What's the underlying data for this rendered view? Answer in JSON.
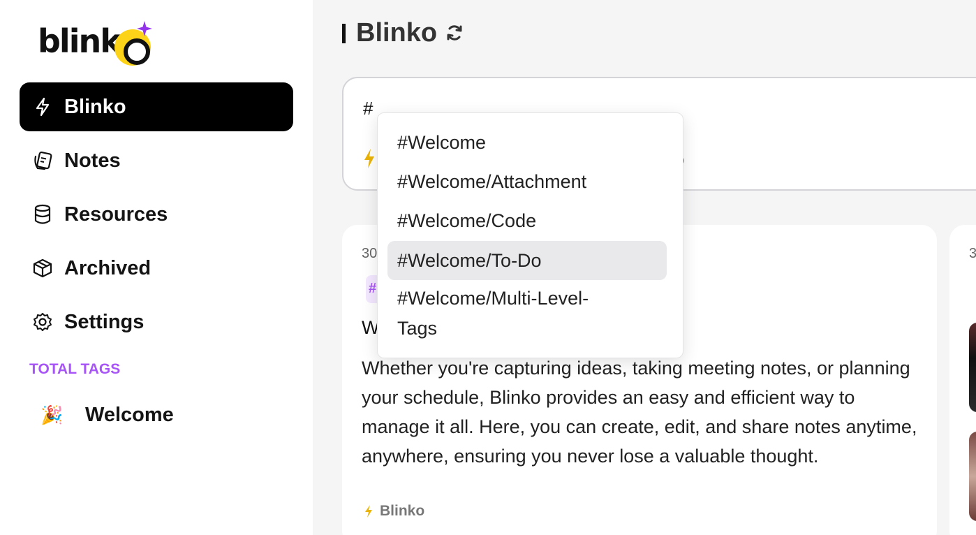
{
  "brand": {
    "logo_text": "blink"
  },
  "sidebar": {
    "items": [
      {
        "label": "Blinko",
        "icon": "bolt-icon",
        "active": true
      },
      {
        "label": "Notes",
        "icon": "notes-icon",
        "active": false
      },
      {
        "label": "Resources",
        "icon": "database-icon",
        "active": false
      },
      {
        "label": "Archived",
        "icon": "archive-box-icon",
        "active": false
      },
      {
        "label": "Settings",
        "icon": "gear-icon",
        "active": false
      }
    ],
    "tags_title": "TOTAL TAGS",
    "tags": [
      {
        "emoji": "🎉",
        "label": "Welcome"
      }
    ]
  },
  "header": {
    "title": "Blinko"
  },
  "editor": {
    "value": "#"
  },
  "tag_suggestions": {
    "items": [
      "#Welcome",
      "#Welcome/Attachment",
      "#Welcome/Code",
      "#Welcome/To-Do",
      "#Welcome/Multi-Level-Tags"
    ],
    "selected_index": 3
  },
  "note_card": {
    "date": "30",
    "tag_prefix": "#",
    "heading_fragment": "W",
    "body": "Whether you're capturing ideas, taking meeting notes, or planning your schedule, Blinko provides an easy and efficient way to manage it all. Here, you can create, edit, and share notes anytime, anywhere, ensuring you never lose a valuable thought.",
    "footer_label": "Blinko"
  },
  "second_card": {
    "date": "3"
  },
  "colors": {
    "accent_purple": "#a855f7",
    "brand_yellow": "#fcd318",
    "active_bg": "#000000",
    "bolt_yellow": "#eab308"
  }
}
